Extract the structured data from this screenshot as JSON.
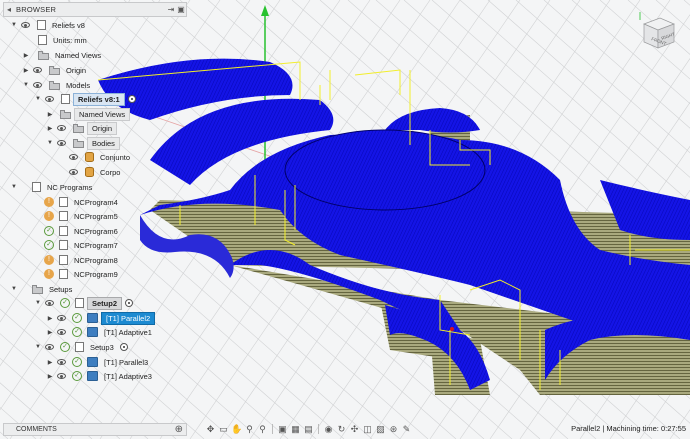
{
  "browser": {
    "title": "BROWSER",
    "tree": [
      {
        "label": "Reliefs v8",
        "kind": "root"
      },
      {
        "label": "Units: mm",
        "kind": "doc"
      },
      {
        "label": "Named Views",
        "kind": "folder"
      },
      {
        "label": "Origin",
        "kind": "folder"
      },
      {
        "label": "Models",
        "kind": "folder"
      },
      {
        "label": "Reliefs v8:1",
        "kind": "component"
      },
      {
        "label": "Named Views",
        "kind": "folder"
      },
      {
        "label": "Origin",
        "kind": "folder"
      },
      {
        "label": "Bodies",
        "kind": "folder"
      },
      {
        "label": "Conjunto",
        "kind": "body"
      },
      {
        "label": "Corpo",
        "kind": "body"
      },
      {
        "label": "NC Programs",
        "kind": "folder"
      },
      {
        "label": "NCProgram4",
        "kind": "nc",
        "status": "warn"
      },
      {
        "label": "NCProgram5",
        "kind": "nc",
        "status": "warn"
      },
      {
        "label": "NCProgram6",
        "kind": "nc",
        "status": "ok"
      },
      {
        "label": "NCProgram7",
        "kind": "nc",
        "status": "ok"
      },
      {
        "label": "NCProgram8",
        "kind": "nc",
        "status": "warn"
      },
      {
        "label": "NCProgram9",
        "kind": "nc",
        "status": "warn"
      },
      {
        "label": "Setups",
        "kind": "folder"
      },
      {
        "label": "Setup2",
        "kind": "setup"
      },
      {
        "label": "[T1] Parallel2",
        "kind": "op",
        "selected": true
      },
      {
        "label": "[T1] Adaptive1",
        "kind": "op"
      },
      {
        "label": "Setup3",
        "kind": "setup"
      },
      {
        "label": "[T1] Parallel3",
        "kind": "op"
      },
      {
        "label": "[T1] Adaptive3",
        "kind": "op"
      }
    ]
  },
  "comments": {
    "label": "COMMENTS"
  },
  "status": {
    "text": "Parallel2 | Machining time: 0:27:55"
  },
  "viewcube": {
    "front": "FRONT",
    "right": "RIGHT",
    "top": "TOP"
  },
  "colors": {
    "toolpath_blue": "#1414e6",
    "stock_olive": "#a9a97e",
    "link_yellow": "#f2ee2a",
    "selection": "#1c8ad1",
    "grid": "#c9cacc"
  },
  "icons": [
    "eye-icon",
    "folder-icon",
    "document-icon",
    "body-icon",
    "tool-icon",
    "check-icon",
    "warning-icon",
    "radio-icon"
  ]
}
